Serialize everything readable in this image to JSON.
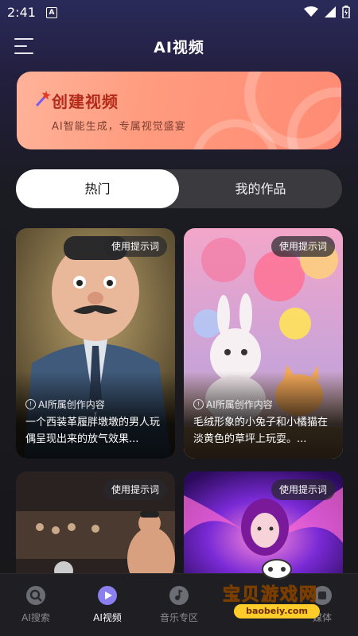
{
  "status": {
    "time": "2:41",
    "notif_letter": "A"
  },
  "header": {
    "title": "AI视频"
  },
  "banner": {
    "title": "创建视频",
    "subtitle": "AI智能生成，专属视觉盛宴"
  },
  "tabs": [
    {
      "label": "热门"
    },
    {
      "label": "我的作品"
    }
  ],
  "cards": [
    {
      "pill": "使用提示词",
      "origin": "AI所属创作内容",
      "desc": "一个西装革履胖墩墩的男人玩偶呈现出来的放气效果..."
    },
    {
      "pill": "使用提示词",
      "origin": "AI所属创作内容",
      "desc": "毛绒形象的小兔子和小橘猫在淡黄色的草坪上玩耍。..."
    },
    {
      "pill": "使用提示词"
    },
    {
      "pill": "使用提示词"
    }
  ],
  "nav": [
    {
      "label": "AI搜索"
    },
    {
      "label": "AI视频"
    },
    {
      "label": "音乐专区"
    },
    {
      "label": "媒体"
    }
  ],
  "watermark": {
    "text": "宝贝游戏网",
    "url": "baobeiy.com"
  },
  "colors": {
    "accent_banner": "#ff9b7e",
    "banner_title": "#b32a1a",
    "play_icon": "#8b7ff0"
  }
}
